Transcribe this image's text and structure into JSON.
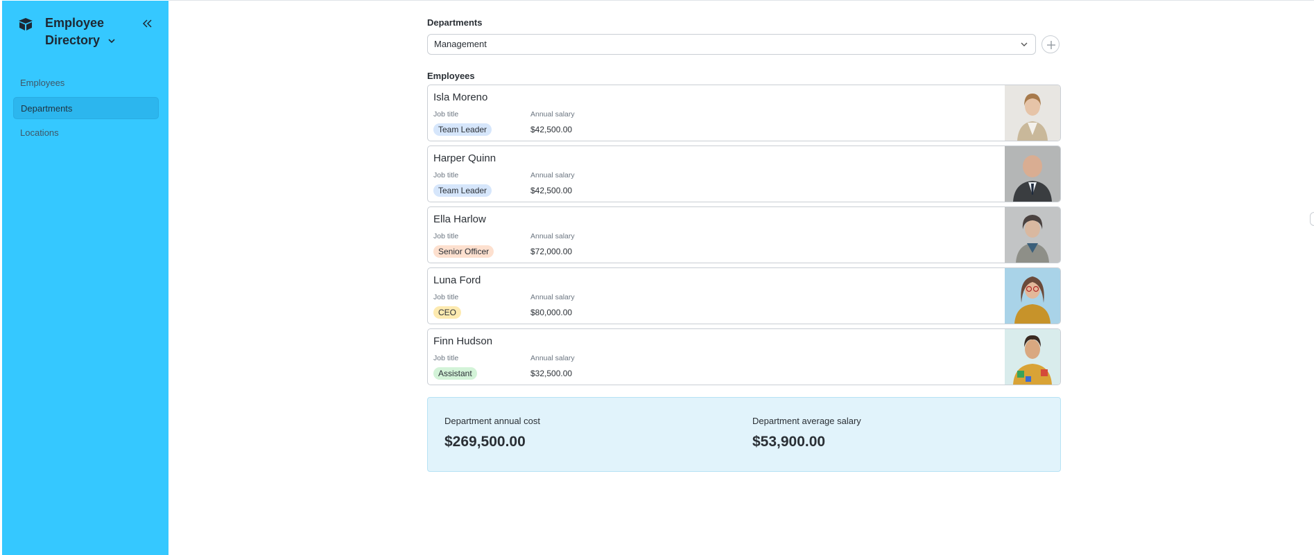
{
  "app": {
    "title": "Employee Directory",
    "accent_color": "#35c8ff"
  },
  "sidebar": {
    "items": [
      {
        "label": "Employees",
        "active": false
      },
      {
        "label": "Departments",
        "active": true
      },
      {
        "label": "Locations",
        "active": false
      }
    ]
  },
  "main": {
    "departments_label": "Departments",
    "selected_department": "Management",
    "employees_label": "Employees",
    "employees": [
      {
        "name": "Isla Moreno",
        "job_title_label": "Job title",
        "job_title": "Team Leader",
        "job_color": "#d6e6fb",
        "salary_label": "Annual salary",
        "salary": "$42,500.00",
        "photo_icon": "woman-portrait-photo"
      },
      {
        "name": "Harper Quinn",
        "job_title_label": "Job title",
        "job_title": "Team Leader",
        "job_color": "#d6e6fb",
        "salary_label": "Annual salary",
        "salary": "$42,500.00",
        "photo_icon": "man-portrait-photo"
      },
      {
        "name": "Ella Harlow",
        "job_title_label": "Job title",
        "job_title": "Senior Officer",
        "job_color": "#fde0cf",
        "salary_label": "Annual salary",
        "salary": "$72,000.00",
        "photo_icon": "woman-portrait-photo"
      },
      {
        "name": "Luna Ford",
        "job_title_label": "Job title",
        "job_title": "CEO",
        "job_color": "#fdeab0",
        "salary_label": "Annual salary",
        "salary": "$80,000.00",
        "photo_icon": "woman-portrait-photo"
      },
      {
        "name": "Finn Hudson",
        "job_title_label": "Job title",
        "job_title": "Assistant",
        "job_color": "#d3f3d8",
        "salary_label": "Annual salary",
        "salary": "$32,500.00",
        "photo_icon": "man-portrait-photo"
      }
    ],
    "summary": {
      "annual_cost_label": "Department annual cost",
      "annual_cost": "$269,500.00",
      "average_salary_label": "Department average salary",
      "average_salary": "$53,900.00"
    }
  }
}
